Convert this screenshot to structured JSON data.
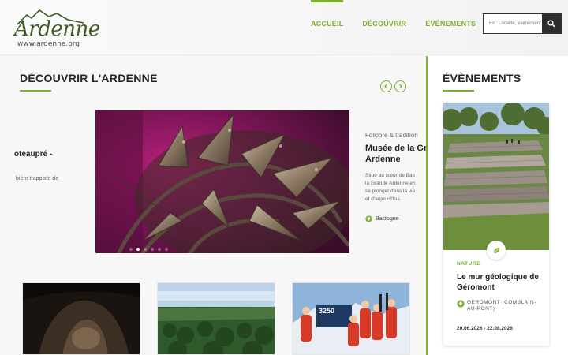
{
  "logo": {
    "word": "Ardenne",
    "url": "www.ardenne.org"
  },
  "nav": {
    "items": [
      {
        "label": "ACCUEIL"
      },
      {
        "label": "DÉCOUVRIR"
      },
      {
        "label": "ÉVÉNEMENTS"
      }
    ]
  },
  "search": {
    "placeholder": "Ex : Localité, événement"
  },
  "main": {
    "title": "DÉCOUVRIR L'ARDENNE",
    "prev_card": {
      "title": "oteaupré -",
      "text": "bière trappiste de"
    },
    "next_card": {
      "category": "Folklore & tradition",
      "title_line1": "Musée de la Gr",
      "title_line2": "Ardenne",
      "desc_line1": "Situé au cœur de Bas",
      "desc_line2": "la Grande Ardenne en",
      "desc_line3": "se plonger dans la vie",
      "desc_line4": "et d'aujourd'hui.",
      "location": "Bastogne"
    },
    "slider": {
      "count": 6,
      "active_index": 1
    },
    "thumbs": [
      {
        "badge": ""
      },
      {
        "badge": ""
      },
      {
        "badge": "3250"
      }
    ]
  },
  "aside": {
    "title": "ÉVÈNEMENTS",
    "event": {
      "category": "NATURE",
      "title": "Le mur géologique de Géromont",
      "location": "GEROMONT (COMBLAIN-AU-PONT)",
      "date": "20.06.2026 - 22.08.2026"
    }
  },
  "colors": {
    "accent": "#7ab02b",
    "dark": "#2d2d2d",
    "logo_green": "#3e5a23"
  },
  "icons": [
    "mountain-logo-icon",
    "search-icon",
    "chevron-left-icon",
    "chevron-right-icon",
    "location-pin-icon",
    "leaf-icon"
  ]
}
